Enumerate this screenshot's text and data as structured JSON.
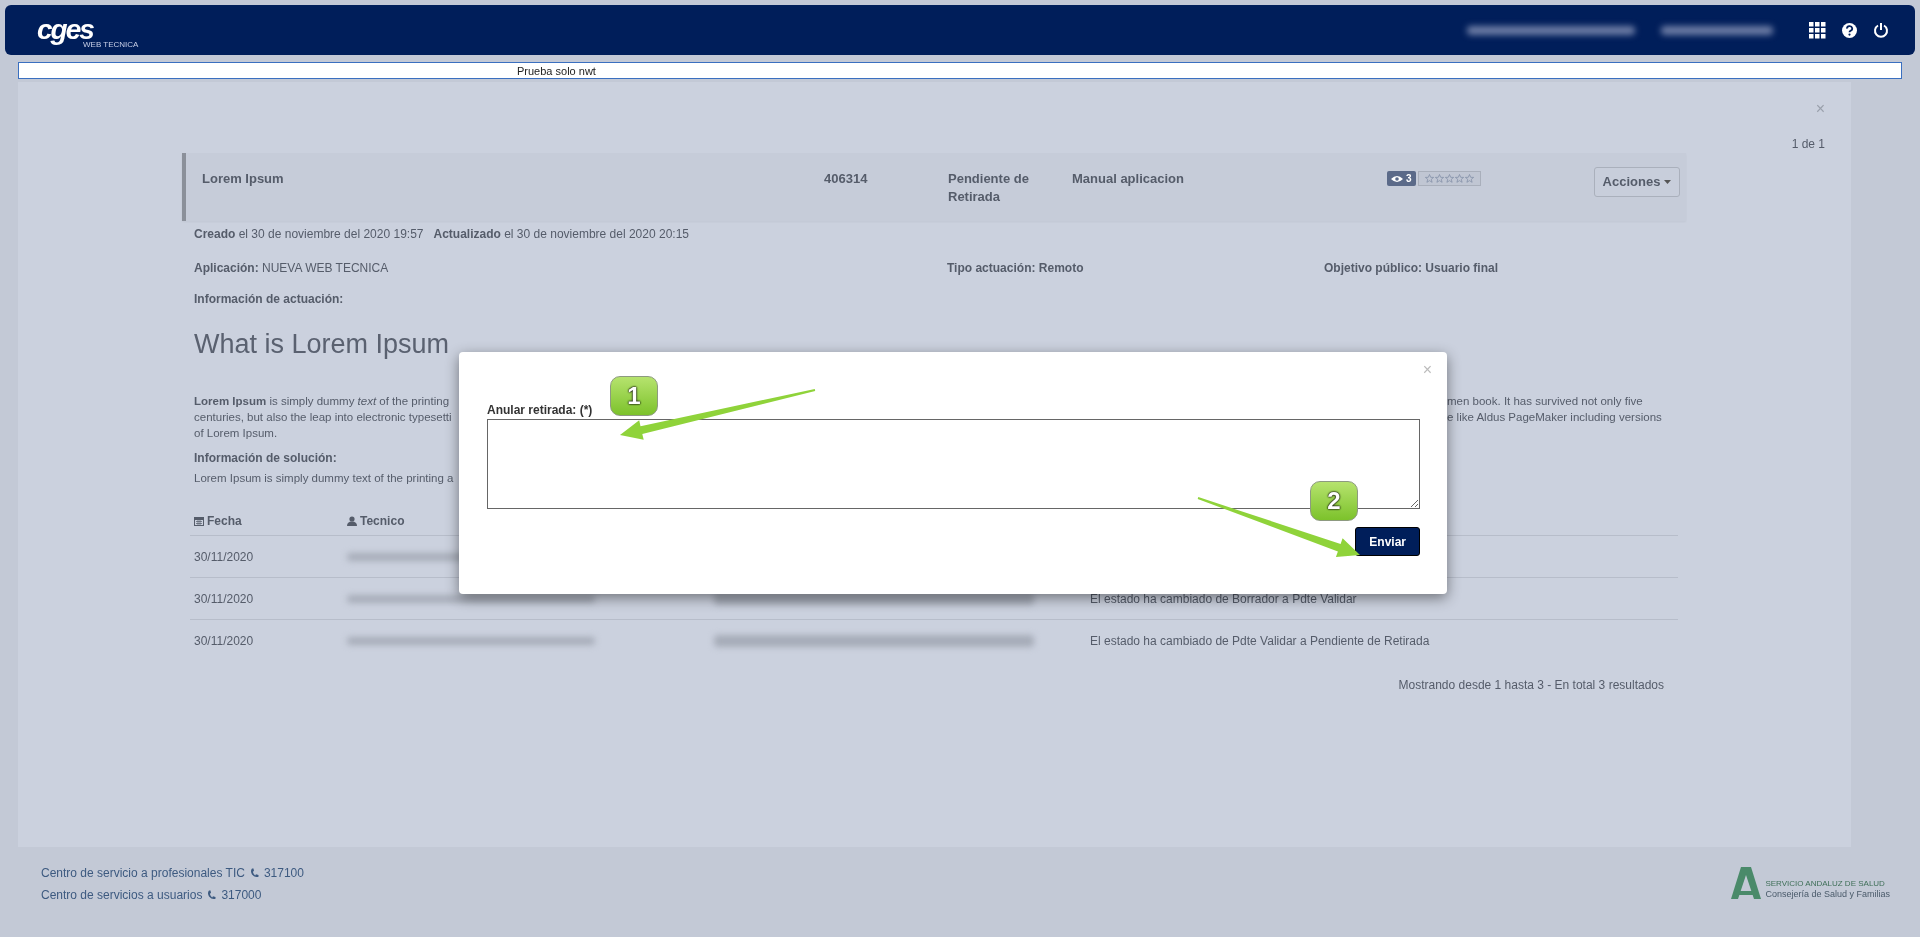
{
  "header": {
    "logo": {
      "title": "cges",
      "subtitle": "WEB TECNICA"
    }
  },
  "notice": "Prueba solo nwt",
  "panel": {
    "close": "×",
    "pagination": "1 de 1"
  },
  "incident": {
    "title": "Lorem Ipsum",
    "number": "406314",
    "status": "Pendiente de Retirada",
    "category": "Manual aplicacion",
    "views": "3",
    "stars": 0,
    "actions": "Acciones"
  },
  "dates": [
    {
      "label": "Creado",
      "value": "el 30 de noviembre del 2020 19:57"
    },
    {
      "label": "Actualizado",
      "value": "el 30 de noviembre del 2020 20:15"
    }
  ],
  "fields": [
    {
      "label": "Aplicación:",
      "value": "NUEVA WEB TECNICA",
      "value_bold": false
    },
    {
      "label": "Tipo actuación:",
      "value": "Remoto",
      "value_bold": true
    },
    {
      "label": "Objetivo público:",
      "value": "Usuario final",
      "value_bold": true
    }
  ],
  "actuacion": {
    "label": "Información de actuación:",
    "heading": "What is Lorem Ipsum",
    "lines_left": [
      "**Lorem Ipsum** is simply dummy *text* of the printing",
      "centuries, but also the leap into electronic typesetti",
      "of Lorem Ipsum."
    ],
    "lines_right": [
      "men book. It has survived not only five",
      "e like Aldus PageMaker including versions"
    ]
  },
  "solucion": {
    "label": "Información de solución:",
    "text": "Lorem Ipsum is simply dummy text of the printing a"
  },
  "table": {
    "columns": [
      {
        "label": "Fecha"
      },
      {
        "label": "Tecnico"
      }
    ],
    "rows": [
      {
        "date": "30/11/2020"
      },
      {
        "date": "30/11/2020",
        "description": "El estado ha cambiado de Borrador a Pdte Validar"
      },
      {
        "date": "30/11/2020",
        "description": "El estado ha cambiado de Pdte Validar a Pendiente de Retirada"
      }
    ],
    "summary": "Mostrando desde 1 hasta 3 - En total 3 resultados"
  },
  "modal": {
    "close": "×",
    "label": "Anular retirada:",
    "required": "(*)",
    "submit": "Enviar"
  },
  "annotations": [
    {
      "label": "1"
    },
    {
      "label": "2"
    }
  ],
  "footer": {
    "contacts": [
      {
        "text": "Centro de servicio a profesionales TIC",
        "phone": "317100"
      },
      {
        "text": "Centro de servicios a usuarios",
        "phone": "317000"
      }
    ],
    "logo": {
      "line1": "SERVICIO ANDALUZ DE SALUD",
      "line2": "Consejería de Salud y Familias"
    }
  }
}
